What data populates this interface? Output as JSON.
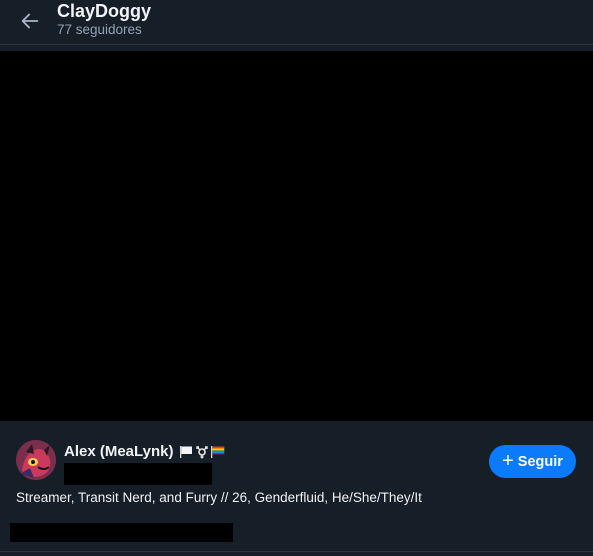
{
  "header": {
    "title": "ClayDoggy",
    "followers": "77 seguidores",
    "back_icon": "arrow-left-icon"
  },
  "banner": {
    "color": "#000000"
  },
  "profile": {
    "display_name": "Alex (MeaLynk)",
    "name_emojis": [
      "white-flag-icon",
      "transgender-symbol-icon",
      "rainbow-flag-icon"
    ],
    "follow_label": "Seguir",
    "follow_icon": "plus-icon",
    "bio": "Streamer, Transit Nerd, and Furry // 26, Genderfluid, He/She/They/It",
    "avatar_icon": "avatar-image"
  },
  "colors": {
    "background": "#161e27",
    "accent": "#0a7aff",
    "text_primary": "#f1f3f5",
    "text_secondary": "#8fa3b8"
  }
}
